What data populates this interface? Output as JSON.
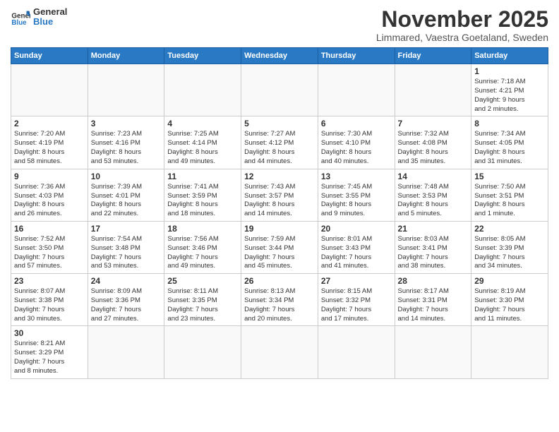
{
  "header": {
    "logo_general": "General",
    "logo_blue": "Blue",
    "month_title": "November 2025",
    "location": "Limmared, Vaestra Goetaland, Sweden"
  },
  "weekdays": [
    "Sunday",
    "Monday",
    "Tuesday",
    "Wednesday",
    "Thursday",
    "Friday",
    "Saturday"
  ],
  "days": [
    {
      "num": "",
      "info": ""
    },
    {
      "num": "",
      "info": ""
    },
    {
      "num": "",
      "info": ""
    },
    {
      "num": "",
      "info": ""
    },
    {
      "num": "",
      "info": ""
    },
    {
      "num": "",
      "info": ""
    },
    {
      "num": "1",
      "info": "Sunrise: 7:18 AM\nSunset: 4:21 PM\nDaylight: 9 hours\nand 2 minutes."
    },
    {
      "num": "2",
      "info": "Sunrise: 7:20 AM\nSunset: 4:19 PM\nDaylight: 8 hours\nand 58 minutes."
    },
    {
      "num": "3",
      "info": "Sunrise: 7:23 AM\nSunset: 4:16 PM\nDaylight: 8 hours\nand 53 minutes."
    },
    {
      "num": "4",
      "info": "Sunrise: 7:25 AM\nSunset: 4:14 PM\nDaylight: 8 hours\nand 49 minutes."
    },
    {
      "num": "5",
      "info": "Sunrise: 7:27 AM\nSunset: 4:12 PM\nDaylight: 8 hours\nand 44 minutes."
    },
    {
      "num": "6",
      "info": "Sunrise: 7:30 AM\nSunset: 4:10 PM\nDaylight: 8 hours\nand 40 minutes."
    },
    {
      "num": "7",
      "info": "Sunrise: 7:32 AM\nSunset: 4:08 PM\nDaylight: 8 hours\nand 35 minutes."
    },
    {
      "num": "8",
      "info": "Sunrise: 7:34 AM\nSunset: 4:05 PM\nDaylight: 8 hours\nand 31 minutes."
    },
    {
      "num": "9",
      "info": "Sunrise: 7:36 AM\nSunset: 4:03 PM\nDaylight: 8 hours\nand 26 minutes."
    },
    {
      "num": "10",
      "info": "Sunrise: 7:39 AM\nSunset: 4:01 PM\nDaylight: 8 hours\nand 22 minutes."
    },
    {
      "num": "11",
      "info": "Sunrise: 7:41 AM\nSunset: 3:59 PM\nDaylight: 8 hours\nand 18 minutes."
    },
    {
      "num": "12",
      "info": "Sunrise: 7:43 AM\nSunset: 3:57 PM\nDaylight: 8 hours\nand 14 minutes."
    },
    {
      "num": "13",
      "info": "Sunrise: 7:45 AM\nSunset: 3:55 PM\nDaylight: 8 hours\nand 9 minutes."
    },
    {
      "num": "14",
      "info": "Sunrise: 7:48 AM\nSunset: 3:53 PM\nDaylight: 8 hours\nand 5 minutes."
    },
    {
      "num": "15",
      "info": "Sunrise: 7:50 AM\nSunset: 3:51 PM\nDaylight: 8 hours\nand 1 minute."
    },
    {
      "num": "16",
      "info": "Sunrise: 7:52 AM\nSunset: 3:50 PM\nDaylight: 7 hours\nand 57 minutes."
    },
    {
      "num": "17",
      "info": "Sunrise: 7:54 AM\nSunset: 3:48 PM\nDaylight: 7 hours\nand 53 minutes."
    },
    {
      "num": "18",
      "info": "Sunrise: 7:56 AM\nSunset: 3:46 PM\nDaylight: 7 hours\nand 49 minutes."
    },
    {
      "num": "19",
      "info": "Sunrise: 7:59 AM\nSunset: 3:44 PM\nDaylight: 7 hours\nand 45 minutes."
    },
    {
      "num": "20",
      "info": "Sunrise: 8:01 AM\nSunset: 3:43 PM\nDaylight: 7 hours\nand 41 minutes."
    },
    {
      "num": "21",
      "info": "Sunrise: 8:03 AM\nSunset: 3:41 PM\nDaylight: 7 hours\nand 38 minutes."
    },
    {
      "num": "22",
      "info": "Sunrise: 8:05 AM\nSunset: 3:39 PM\nDaylight: 7 hours\nand 34 minutes."
    },
    {
      "num": "23",
      "info": "Sunrise: 8:07 AM\nSunset: 3:38 PM\nDaylight: 7 hours\nand 30 minutes."
    },
    {
      "num": "24",
      "info": "Sunrise: 8:09 AM\nSunset: 3:36 PM\nDaylight: 7 hours\nand 27 minutes."
    },
    {
      "num": "25",
      "info": "Sunrise: 8:11 AM\nSunset: 3:35 PM\nDaylight: 7 hours\nand 23 minutes."
    },
    {
      "num": "26",
      "info": "Sunrise: 8:13 AM\nSunset: 3:34 PM\nDaylight: 7 hours\nand 20 minutes."
    },
    {
      "num": "27",
      "info": "Sunrise: 8:15 AM\nSunset: 3:32 PM\nDaylight: 7 hours\nand 17 minutes."
    },
    {
      "num": "28",
      "info": "Sunrise: 8:17 AM\nSunset: 3:31 PM\nDaylight: 7 hours\nand 14 minutes."
    },
    {
      "num": "29",
      "info": "Sunrise: 8:19 AM\nSunset: 3:30 PM\nDaylight: 7 hours\nand 11 minutes."
    },
    {
      "num": "30",
      "info": "Sunrise: 8:21 AM\nSunset: 3:29 PM\nDaylight: 7 hours\nand 8 minutes."
    },
    {
      "num": "",
      "info": ""
    },
    {
      "num": "",
      "info": ""
    },
    {
      "num": "",
      "info": ""
    },
    {
      "num": "",
      "info": ""
    },
    {
      "num": "",
      "info": ""
    },
    {
      "num": "",
      "info": ""
    }
  ]
}
